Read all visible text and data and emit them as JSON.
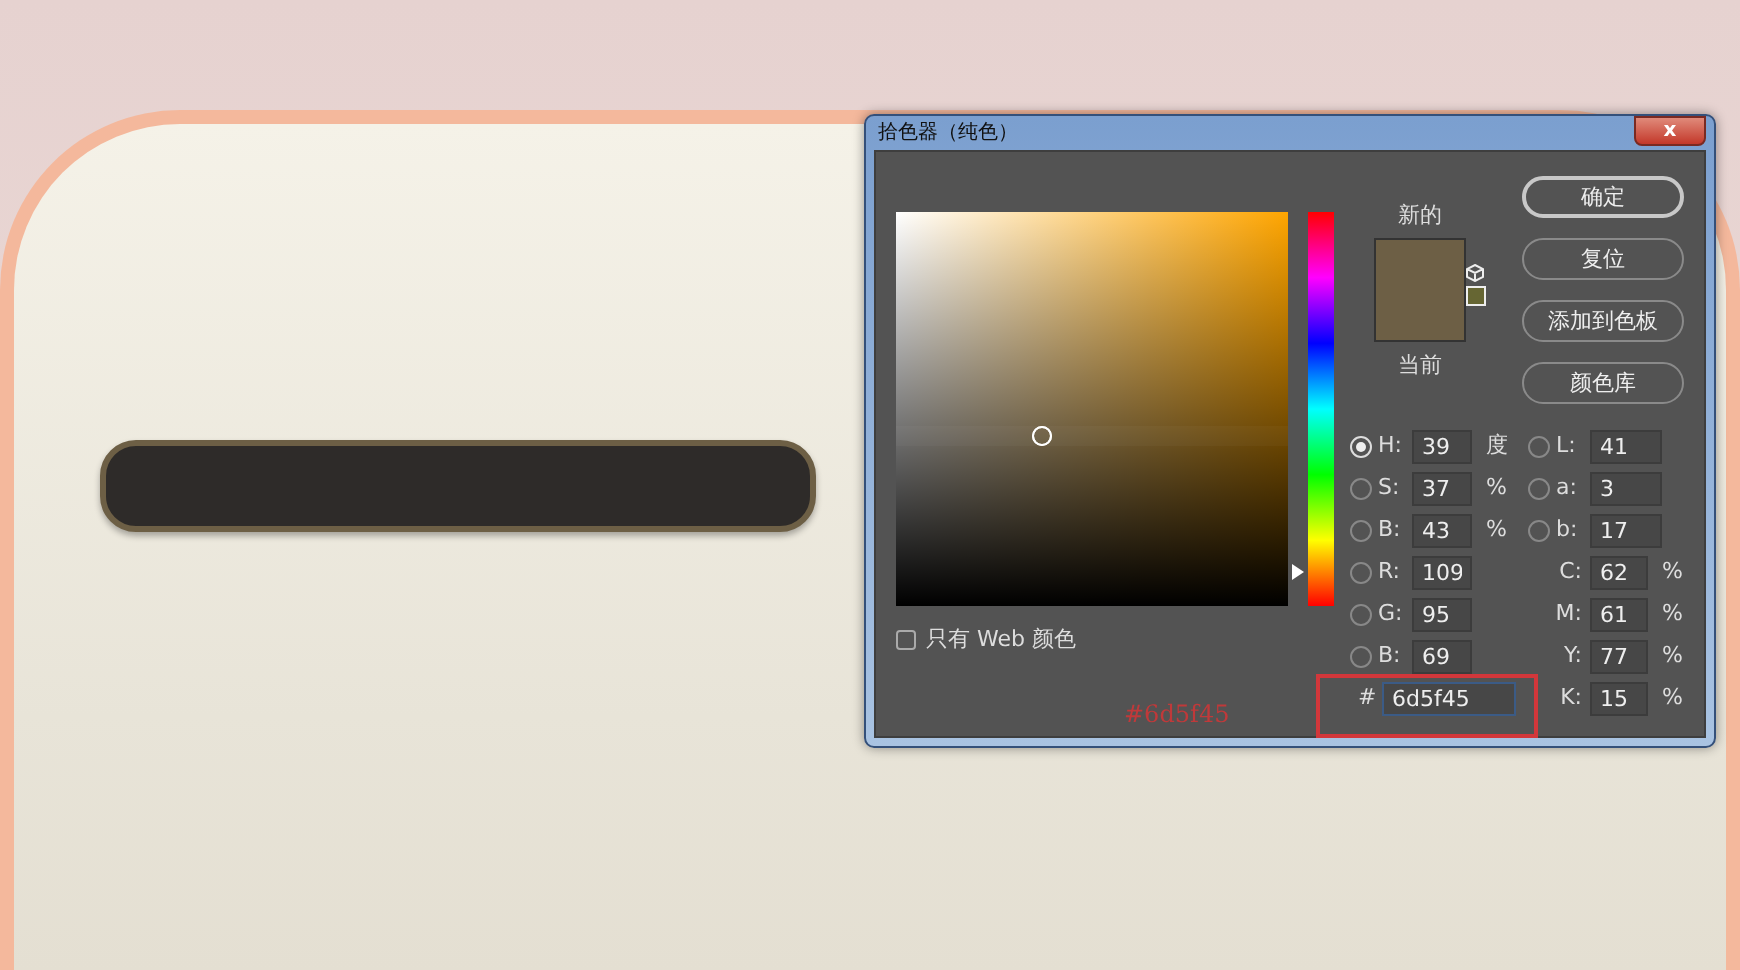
{
  "dialog": {
    "title": "拾色器（纯色）",
    "close": "x"
  },
  "color_field": {
    "saturation": {
      "level": 0.37
    },
    "brightness": {
      "level": 0.43
    }
  },
  "hue_slider": {
    "level": 0.108
  },
  "preview": {
    "new": {
      "label": "新的",
      "color": "#6d5f45"
    },
    "current": {
      "label": "当前",
      "color": "#6d5f45"
    },
    "web_safe": {
      "color": "#666633"
    }
  },
  "buttons": [
    {
      "label": "确定",
      "default": true
    },
    {
      "label": "复位",
      "default": false
    },
    {
      "label": "添加到色板",
      "default": false
    },
    {
      "label": "颜色库",
      "default": false
    }
  ],
  "left_fields": [
    {
      "kind": "radio",
      "label": "H:",
      "value": "39",
      "unit": "度",
      "selected": true
    },
    {
      "kind": "radio",
      "label": "S:",
      "value": "37",
      "unit": "%",
      "selected": false
    },
    {
      "kind": "radio",
      "label": "B:",
      "value": "43",
      "unit": "%",
      "selected": false
    },
    {
      "kind": "radio",
      "label": "R:",
      "value": "109",
      "selected": false
    },
    {
      "kind": "radio",
      "label": "G:",
      "value": "95",
      "selected": false
    },
    {
      "kind": "radio",
      "label": "B:",
      "value": "69",
      "selected": false
    }
  ],
  "right_fields": [
    {
      "kind": "radio",
      "label": "L:",
      "value": "41",
      "selected": false
    },
    {
      "kind": "radio",
      "label": "a:",
      "value": "3",
      "selected": false
    },
    {
      "kind": "radio",
      "label": "b:",
      "value": "17",
      "selected": false
    },
    {
      "kind": "plain",
      "label": "C:",
      "value": "62",
      "unit": "%"
    },
    {
      "kind": "plain",
      "label": "M:",
      "value": "61",
      "unit": "%"
    },
    {
      "kind": "plain",
      "label": "Y:",
      "value": "77",
      "unit": "%"
    },
    {
      "kind": "plain",
      "label": "K:",
      "value": "15",
      "unit": "%"
    }
  ],
  "web_only": {
    "label": "只有 Web 颜色",
    "checked": false
  },
  "hex": {
    "label": "#",
    "value": "6d5f45"
  },
  "annotation": {
    "text": "#6d5f45"
  }
}
